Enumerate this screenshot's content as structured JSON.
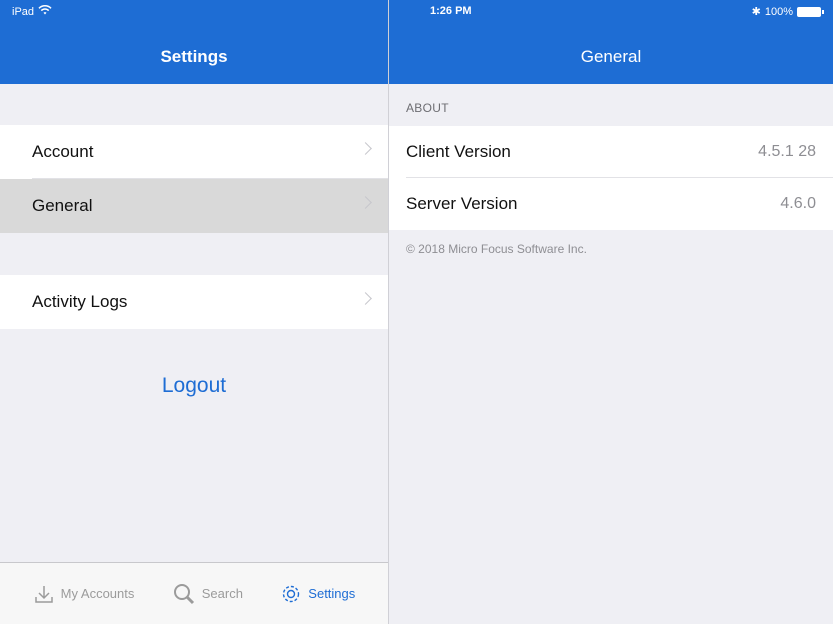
{
  "status": {
    "device": "iPad",
    "time": "1:26 PM",
    "battery": "100%"
  },
  "left_nav": {
    "title": "Settings"
  },
  "right_nav": {
    "title": "General"
  },
  "settings_menu": {
    "items": [
      {
        "label": "Account"
      },
      {
        "label": "General"
      },
      {
        "label": "Activity Logs"
      }
    ],
    "logout_label": "Logout"
  },
  "tabbar": {
    "tabs": [
      {
        "label": "My Accounts",
        "icon": "download-icon"
      },
      {
        "label": "Search",
        "icon": "search-icon"
      },
      {
        "label": "Settings",
        "icon": "gear-icon"
      }
    ],
    "active": "Settings"
  },
  "general": {
    "section_header": "ABOUT",
    "rows": [
      {
        "label": "Client Version",
        "value": "4.5.1 28"
      },
      {
        "label": "Server Version",
        "value": "4.6.0"
      }
    ],
    "copyright": "© 2018 Micro Focus Software Inc."
  },
  "colors": {
    "accent": "#1e6dd4",
    "background": "#efeff4",
    "selected_row": "#d9d9d9"
  }
}
